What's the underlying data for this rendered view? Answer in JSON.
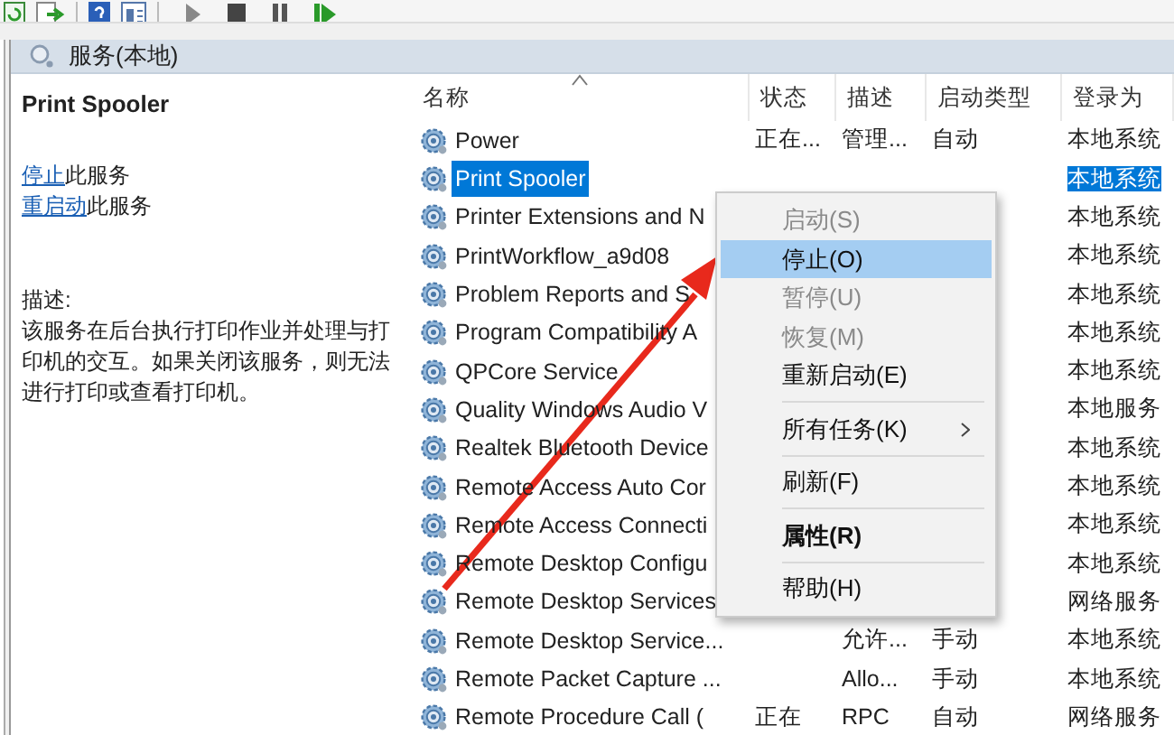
{
  "header": {
    "title": "服务(本地)"
  },
  "detail": {
    "title": "Print Spooler",
    "actions": [
      {
        "link": "停止",
        "text": "此服务"
      },
      {
        "link": "重启动",
        "text": "此服务"
      }
    ],
    "description_label": "描述:",
    "description": "该服务在后台执行打印作业并处理与打印机的交互。如果关闭该服务，则无法进行打印或查看打印机。"
  },
  "table": {
    "columns": [
      {
        "label": "名称",
        "sorted": true
      },
      {
        "label": "状态",
        "sorted": false
      },
      {
        "label": "描述",
        "sorted": false
      },
      {
        "label": "启动类型",
        "sorted": false
      },
      {
        "label": "登录为",
        "sorted": false
      }
    ],
    "rows": [
      {
        "name": "Power",
        "status": "正在...",
        "description": "管理...",
        "startup": "自动",
        "logon": "本地系统",
        "selected": false
      },
      {
        "name": "Print Spooler",
        "logon": "本地系统",
        "selected": true
      },
      {
        "name": "Printer Extensions and N",
        "logon": "本地系统",
        "selected": false
      },
      {
        "name": "PrintWorkflow_a9d08",
        "logon": "本地系统",
        "selected": false
      },
      {
        "name": "Problem Reports and S",
        "logon": "本地系统",
        "selected": false
      },
      {
        "name": "Program Compatibility A",
        "logon": "本地系统",
        "selected": false
      },
      {
        "name": "QPCore Service",
        "logon": "本地系统",
        "selected": false
      },
      {
        "name": "Quality Windows Audio V",
        "logon": "本地服务",
        "selected": false
      },
      {
        "name": "Realtek Bluetooth Device",
        "logon": "本地系统",
        "selected": false
      },
      {
        "name": "Remote Access Auto Cor",
        "logon": "本地系统",
        "selected": false
      },
      {
        "name": "Remote Access Connecti",
        "logon": "本地系统",
        "selected": false
      },
      {
        "name": "Remote Desktop Configu",
        "logon": "本地系统",
        "selected": false
      },
      {
        "name": "Remote Desktop Services",
        "logon": "网络服务",
        "selected": false
      },
      {
        "name": "Remote Desktop Service...",
        "description": "允许...",
        "startup": "手动",
        "logon": "本地系统",
        "selected": false
      },
      {
        "name": "Remote Packet Capture ...",
        "description": "Allo...",
        "startup": "手动",
        "logon": "本地系统",
        "selected": false
      },
      {
        "name": "Remote Procedure Call (",
        "status": "正在",
        "description": "RPC",
        "startup": "自动",
        "logon": "网络服务",
        "selected": false
      }
    ]
  },
  "context_menu": {
    "items": [
      {
        "kind": "item",
        "label": "启动(S)",
        "disabled": true,
        "selected": false,
        "default": false,
        "submenu": false
      },
      {
        "kind": "item",
        "label": "停止(O)",
        "disabled": false,
        "selected": true,
        "default": false,
        "submenu": false
      },
      {
        "kind": "item",
        "label": "暂停(U)",
        "disabled": true,
        "selected": false,
        "default": false,
        "submenu": false
      },
      {
        "kind": "item",
        "label": "恢复(M)",
        "disabled": true,
        "selected": false,
        "default": false,
        "submenu": false
      },
      {
        "kind": "item",
        "label": "重新启动(E)",
        "disabled": false,
        "selected": false,
        "default": false,
        "submenu": false
      },
      {
        "kind": "separator"
      },
      {
        "kind": "item",
        "label": "所有任务(K)",
        "disabled": false,
        "selected": false,
        "default": false,
        "submenu": true
      },
      {
        "kind": "separator"
      },
      {
        "kind": "item",
        "label": "刷新(F)",
        "disabled": false,
        "selected": false,
        "default": false,
        "submenu": false
      },
      {
        "kind": "separator"
      },
      {
        "kind": "item",
        "label": "属性(R)",
        "disabled": false,
        "selected": false,
        "default": true,
        "submenu": false
      },
      {
        "kind": "separator"
      },
      {
        "kind": "item",
        "label": "帮助(H)",
        "disabled": false,
        "selected": false,
        "default": false,
        "submenu": false
      }
    ]
  }
}
